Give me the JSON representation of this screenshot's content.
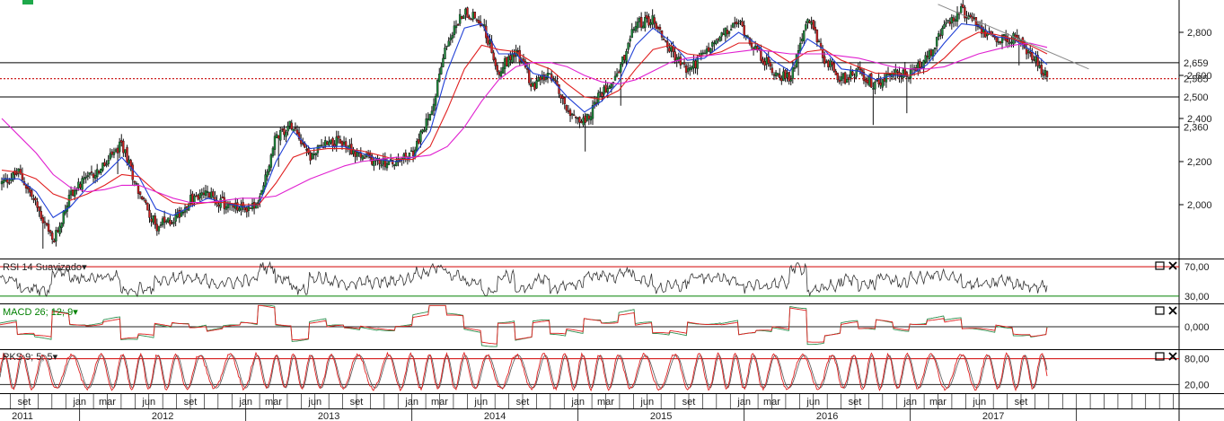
{
  "chart_data": {
    "type": "line",
    "main": {
      "y_ticks": [
        "2,800",
        "2,600",
        "2,400",
        "2,200",
        "2,000"
      ],
      "ylim": [
        1.75,
        2.95
      ],
      "price_labels": [
        {
          "text": "2,659",
          "value": 2.659,
          "color": "#d00000"
        },
        {
          "text": "2,585",
          "value": 2.585,
          "color": "#222222"
        },
        {
          "text": "2,500",
          "value": 2.5,
          "color": "#d00000"
        },
        {
          "text": "2,360",
          "value": 2.36,
          "color": "#d00000"
        }
      ],
      "horizontal_levels": [
        2.659,
        2.5,
        2.36
      ],
      "dotted_level": 2.585,
      "trendline": {
        "from": {
          "date": "2017-03",
          "value": 2.93
        },
        "to": {
          "date": "2017-10",
          "value": 2.63
        }
      },
      "series": [
        {
          "values": [
            2.1,
            2.15,
            2.0,
            1.82,
            2.05,
            2.12,
            2.18,
            2.28,
            2.06,
            1.9,
            1.93,
            2.02,
            2.05,
            2.0,
            1.98,
            2.0,
            2.32,
            2.38,
            2.22,
            2.3,
            2.28,
            2.22,
            2.2,
            2.19,
            2.24,
            2.42,
            2.76,
            2.9,
            2.85,
            2.62,
            2.72,
            2.55,
            2.6,
            2.45,
            2.38,
            2.52,
            2.62,
            2.84,
            2.86,
            2.72,
            2.62,
            2.7,
            2.78,
            2.85,
            2.72,
            2.62,
            2.58,
            2.88,
            2.68,
            2.58,
            2.62,
            2.55,
            2.62,
            2.6,
            2.68,
            2.82,
            2.9,
            2.83,
            2.76,
            2.78,
            2.7,
            2.59
          ]
        },
        {
          "values": [
            2.12,
            2.12,
            2.06,
            1.94,
            1.99,
            2.08,
            2.14,
            2.22,
            2.13,
            1.98,
            1.95,
            1.99,
            2.03,
            2.01,
            1.99,
            2.0,
            2.2,
            2.34,
            2.26,
            2.27,
            2.27,
            2.24,
            2.21,
            2.2,
            2.22,
            2.34,
            2.62,
            2.82,
            2.84,
            2.7,
            2.7,
            2.61,
            2.59,
            2.5,
            2.43,
            2.48,
            2.57,
            2.74,
            2.82,
            2.76,
            2.67,
            2.68,
            2.74,
            2.8,
            2.75,
            2.67,
            2.62,
            2.77,
            2.72,
            2.63,
            2.62,
            2.58,
            2.6,
            2.6,
            2.65,
            2.75,
            2.84,
            2.83,
            2.78,
            2.77,
            2.72,
            2.65
          ]
        },
        {
          "values": [
            2.16,
            2.15,
            2.12,
            2.05,
            2.02,
            2.05,
            2.09,
            2.14,
            2.13,
            2.06,
            2.01,
            2.0,
            2.01,
            2.01,
            2.0,
            2.0,
            2.1,
            2.22,
            2.25,
            2.26,
            2.26,
            2.25,
            2.23,
            2.21,
            2.21,
            2.27,
            2.44,
            2.63,
            2.74,
            2.72,
            2.71,
            2.66,
            2.63,
            2.56,
            2.5,
            2.49,
            2.53,
            2.63,
            2.72,
            2.74,
            2.7,
            2.69,
            2.71,
            2.75,
            2.75,
            2.71,
            2.66,
            2.71,
            2.72,
            2.67,
            2.64,
            2.61,
            2.61,
            2.6,
            2.62,
            2.68,
            2.76,
            2.8,
            2.79,
            2.77,
            2.74,
            2.7
          ]
        },
        {
          "values": [
            2.4,
            2.32,
            2.24,
            2.14,
            2.08,
            2.06,
            2.07,
            2.09,
            2.09,
            2.06,
            2.03,
            2.01,
            2.01,
            2.02,
            2.03,
            2.03,
            2.04,
            2.08,
            2.12,
            2.15,
            2.18,
            2.2,
            2.21,
            2.22,
            2.22,
            2.23,
            2.27,
            2.36,
            2.48,
            2.58,
            2.64,
            2.66,
            2.66,
            2.64,
            2.6,
            2.57,
            2.56,
            2.58,
            2.62,
            2.66,
            2.68,
            2.69,
            2.7,
            2.71,
            2.72,
            2.71,
            2.7,
            2.7,
            2.7,
            2.69,
            2.68,
            2.66,
            2.64,
            2.63,
            2.63,
            2.64,
            2.67,
            2.7,
            2.72,
            2.74,
            2.75,
            2.73
          ]
        }
      ]
    },
    "indicators": [
      {
        "title": "RSI 14 Suavizado",
        "title_color": "#222222",
        "title_arrow": "▾",
        "levels": [
          "70,00",
          "30,00"
        ],
        "level_colors": [
          "#d00000",
          "#008000"
        ],
        "ylim": [
          20,
          80
        ],
        "level_values": [
          70,
          30
        ]
      },
      {
        "title": "MACD 26; 12; 9",
        "title_color": "#008000",
        "title_arrow": "▾",
        "levels": [
          "0,000"
        ],
        "level_colors": [
          "#222222"
        ],
        "ylim": [
          -1,
          1
        ],
        "level_values": [
          0
        ]
      },
      {
        "title": "PKS 9; 5; 5",
        "title_color": "#222222",
        "title_arrow": "▾",
        "levels": [
          "80,00",
          "20,00"
        ],
        "level_colors": [
          "#d00000",
          "#222222"
        ],
        "ylim": [
          0,
          100
        ],
        "level_values": [
          80,
          20
        ]
      }
    ],
    "x_months": [
      {
        "label": "set",
        "date": "2011-09"
      },
      {
        "label": "jan",
        "date": "2012-01"
      },
      {
        "label": "mar",
        "date": "2012-03"
      },
      {
        "label": "jun",
        "date": "2012-06"
      },
      {
        "label": "set",
        "date": "2012-09"
      },
      {
        "label": "jan",
        "date": "2013-01"
      },
      {
        "label": "mar",
        "date": "2013-03"
      },
      {
        "label": "jun",
        "date": "2013-06"
      },
      {
        "label": "set",
        "date": "2013-09"
      },
      {
        "label": "jan",
        "date": "2014-01"
      },
      {
        "label": "mar",
        "date": "2014-03"
      },
      {
        "label": "jun",
        "date": "2014-06"
      },
      {
        "label": "set",
        "date": "2014-09"
      },
      {
        "label": "jan",
        "date": "2015-01"
      },
      {
        "label": "mar",
        "date": "2015-03"
      },
      {
        "label": "jun",
        "date": "2015-06"
      },
      {
        "label": "set",
        "date": "2015-09"
      },
      {
        "label": "jan",
        "date": "2016-01"
      },
      {
        "label": "mar",
        "date": "2016-03"
      },
      {
        "label": "jun",
        "date": "2016-06"
      },
      {
        "label": "set",
        "date": "2016-09"
      },
      {
        "label": "jan",
        "date": "2017-01"
      },
      {
        "label": "mar",
        "date": "2017-03"
      },
      {
        "label": "jun",
        "date": "2017-06"
      },
      {
        "label": "set",
        "date": "2017-09"
      }
    ],
    "x_years": [
      {
        "label": "2011",
        "date": "2011-07"
      },
      {
        "label": "2012",
        "date": "2012-07"
      },
      {
        "label": "2013",
        "date": "2013-07"
      },
      {
        "label": "2014",
        "date": "2014-07"
      },
      {
        "label": "2015",
        "date": "2015-07"
      },
      {
        "label": "2016",
        "date": "2016-07"
      },
      {
        "label": "2017",
        "date": "2017-07"
      }
    ],
    "year_starts": [
      "2012-01",
      "2013-01",
      "2014-01",
      "2015-01",
      "2016-01",
      "2017-01",
      "2018-01"
    ],
    "colors": {
      "up": "#1c8a3a",
      "down": "#cc1f1f",
      "ma_green": "#2f8f4f",
      "ma_blue": "#1f3fd6",
      "ma_red": "#e02020",
      "ma_magenta": "#e020d0",
      "grid": "#000000",
      "trend": "#888888"
    }
  }
}
